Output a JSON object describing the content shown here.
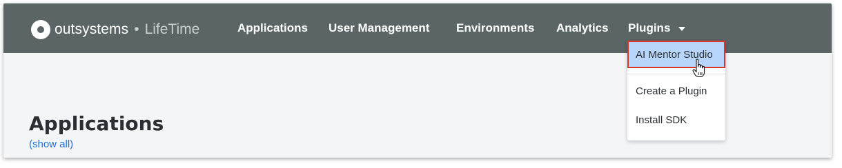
{
  "brand": {
    "name": "outsystems",
    "separator": "•",
    "product": "LifeTime"
  },
  "nav": {
    "applications": "Applications",
    "user_management": "User Management",
    "environments": "Environments",
    "analytics": "Analytics",
    "plugins": "Plugins"
  },
  "plugins_menu": {
    "items": [
      {
        "label": "AI Mentor Studio",
        "state": "hovered-highlighted"
      },
      {
        "label": "Create a Plugin"
      },
      {
        "label": "Install SDK"
      }
    ]
  },
  "main": {
    "title": "Applications",
    "show_all": "(show all)"
  },
  "colors": {
    "topbar": "#5b6565",
    "highlight_fill": "#b8d5fb",
    "highlight_border": "#d9362b",
    "link": "#1e6fd9"
  },
  "icons": {
    "logo": "outsystems-logo-icon",
    "plugins_caret": "chevron-down-icon",
    "cursor": "hand-pointer-icon"
  }
}
